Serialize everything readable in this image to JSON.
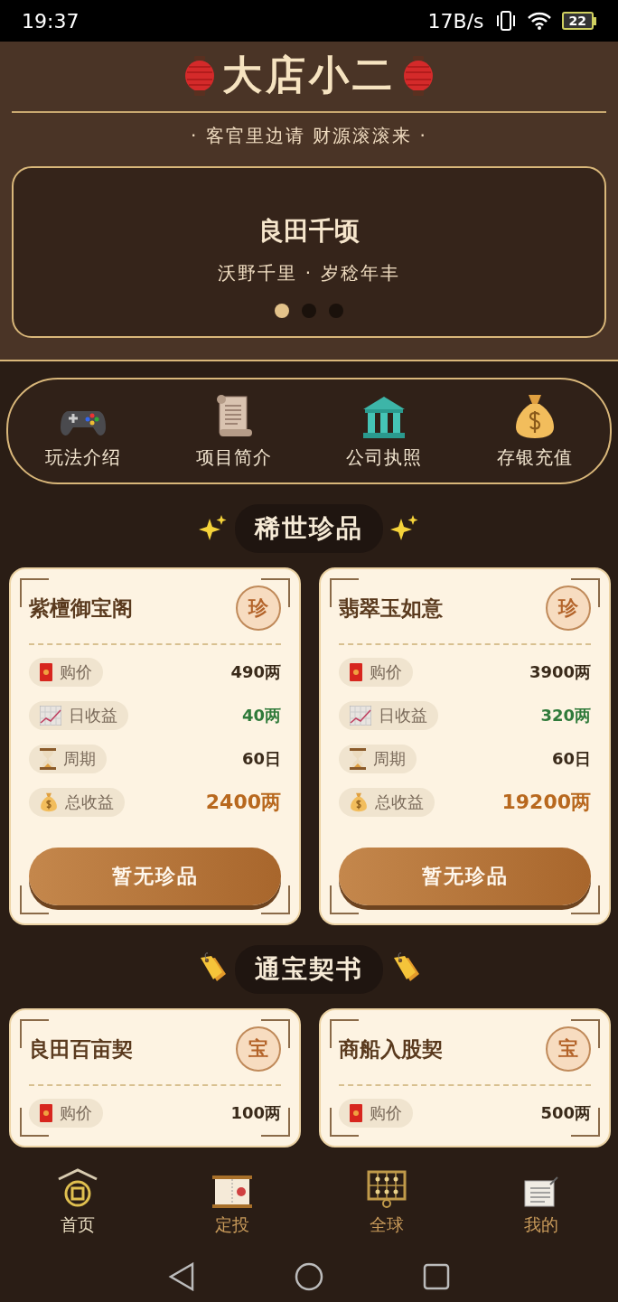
{
  "status_bar": {
    "time": "19:37",
    "speed": "17B/s",
    "battery": "22"
  },
  "header": {
    "title": "大店小二",
    "subtitle": "· 客官里边请 财源滚滚来 ·"
  },
  "banner": {
    "title": "良田千顷",
    "subtitle": "沃野千里 · 岁稔年丰",
    "dots": [
      {
        "selected": true
      },
      {
        "selected": false
      },
      {
        "selected": false
      }
    ]
  },
  "menu": [
    {
      "label": "玩法介绍",
      "kind": "gamepad"
    },
    {
      "label": "项目简介",
      "kind": "scroll"
    },
    {
      "label": "公司执照",
      "kind": "bank"
    },
    {
      "label": "存银充值",
      "kind": "moneybag"
    }
  ],
  "sections": [
    {
      "title": "稀世珍品",
      "kind": "sparkles",
      "cards": [
        {
          "name": "紫檀御宝阁",
          "badge": "珍",
          "rows": [
            {
              "kind": "price",
              "label": "购价",
              "value": "490两"
            },
            {
              "kind": "daily",
              "label": "日收益",
              "value": "40两"
            },
            {
              "kind": "period",
              "label": "周期",
              "value": "60日"
            },
            {
              "kind": "total",
              "label": "总收益",
              "value": "2400两"
            }
          ],
          "button": "暂无珍品"
        },
        {
          "name": "翡翠玉如意",
          "badge": "珍",
          "rows": [
            {
              "kind": "price",
              "label": "购价",
              "value": "3900两"
            },
            {
              "kind": "daily",
              "label": "日收益",
              "value": "320两"
            },
            {
              "kind": "period",
              "label": "周期",
              "value": "60日"
            },
            {
              "kind": "total",
              "label": "总收益",
              "value": "19200两"
            }
          ],
          "button": "暂无珍品"
        }
      ]
    },
    {
      "title": "通宝契书",
      "kind": "tags",
      "cards": [
        {
          "name": "良田百亩契",
          "badge": "宝",
          "rows": [
            {
              "kind": "price",
              "label": "购价",
              "value": "100两"
            }
          ]
        },
        {
          "name": "商船入股契",
          "badge": "宝",
          "rows": [
            {
              "kind": "price",
              "label": "购价",
              "value": "500两"
            }
          ]
        }
      ]
    }
  ],
  "nav": [
    {
      "label": "首页",
      "kind": "home",
      "selected": true
    },
    {
      "label": "定投",
      "kind": "scroll",
      "selected": false
    },
    {
      "label": "全球",
      "kind": "abacus",
      "selected": false
    },
    {
      "label": "我的",
      "kind": "note",
      "selected": false
    }
  ]
}
